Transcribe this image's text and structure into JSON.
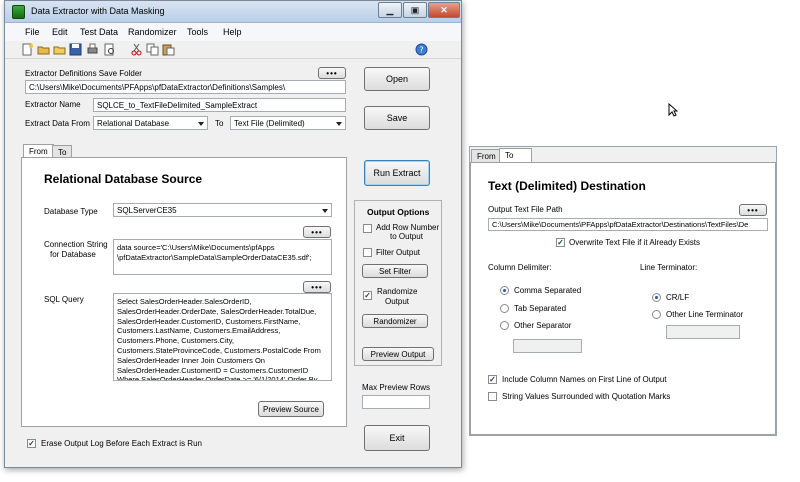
{
  "main_window": {
    "title": "Data Extractor with Data Masking",
    "menu": [
      "File",
      "Edit",
      "Test Data",
      "Randomizer",
      "Tools",
      "Help"
    ],
    "definitions_folder_label": "Extractor Definitions Save Folder",
    "definitions_folder_value": "C:\\Users\\Mike\\Documents\\PFApps\\pfDataExtractor\\Definitions\\Samples\\",
    "extractor_name_label": "Extractor Name",
    "extractor_name_value": "SQLCE_to_TextFileDelimited_SampleExtract",
    "extract_from_label": "Extract Data From",
    "extract_from_value": "Relational Database",
    "to_label": "To",
    "extract_to_value": "Text File (Delimited)",
    "dots_label": "•••",
    "open_button": "Open",
    "save_button": "Save",
    "run_extract_button": "Run Extract",
    "exit_button": "Exit",
    "tabs": [
      "From",
      "To"
    ],
    "erase_log_label": "Erase Output Log Before Each Extract is Run",
    "max_preview_rows_label": "Max Preview Rows"
  },
  "source_panel": {
    "heading": "Relational Database Source",
    "database_type_label": "Database Type",
    "database_type_value": "SQLServerCE35",
    "connection_string_label_1": "Connection String",
    "connection_string_label_2": "for Database",
    "connection_string_value": "data source='C:\\Users\\Mike\\Documents\\pfApps \\pfDataExtractor\\SampleData\\SampleOrderDataCE35.sdf';",
    "sql_query_label": "SQL Query",
    "sql_query_value": "Select SalesOrderHeader.SalesOrderID, SalesOrderHeader.OrderDate, SalesOrderHeader.TotalDue, SalesOrderHeader.CustomerID, Customers.FirstName, Customers.LastName, Customers.EmailAddress, Customers.Phone, Customers.City, Customers.StateProvinceCode, Customers.PostalCode From SalesOrderHeader Inner Join Customers On SalesOrderHeader.CustomerID = Customers.CustomerID Where SalesOrderHeader.OrderDate >= '6/1/2014' Order By",
    "preview_source_button": "Preview Source"
  },
  "output_options": {
    "title": "Output Options",
    "add_row_number_label_1": "Add Row Number",
    "add_row_number_label_2": "to Output",
    "filter_output_label": "Filter Output",
    "set_filter_button": "Set Filter",
    "randomize_label_1": "Randomize",
    "randomize_label_2": "Output",
    "randomizer_button": "Randomizer",
    "preview_output_button": "Preview Output"
  },
  "dest_window": {
    "tabs": [
      "From",
      "To"
    ],
    "heading": "Text (Delimited) Destination",
    "output_path_label": "Output Text File Path",
    "output_path_value": "C:\\Users\\Mike\\Documents\\PFApps\\pfDataExtractor\\Destinations\\TextFiles\\De",
    "overwrite_label": "Overwrite Text File if it Already Exists",
    "column_delimiter_label": "Column Delimiter:",
    "comma_label": "Comma Separated",
    "tab_label": "Tab Separated",
    "other_separator_label": "Other Separator",
    "line_terminator_label": "Line Terminator:",
    "crlf_label": "CR/LF",
    "other_terminator_label": "Other Line Terminator",
    "include_column_names_label": "Include Column Names on First Line of Output",
    "quotation_marks_label": "String Values Surrounded with Quotation Marks"
  }
}
